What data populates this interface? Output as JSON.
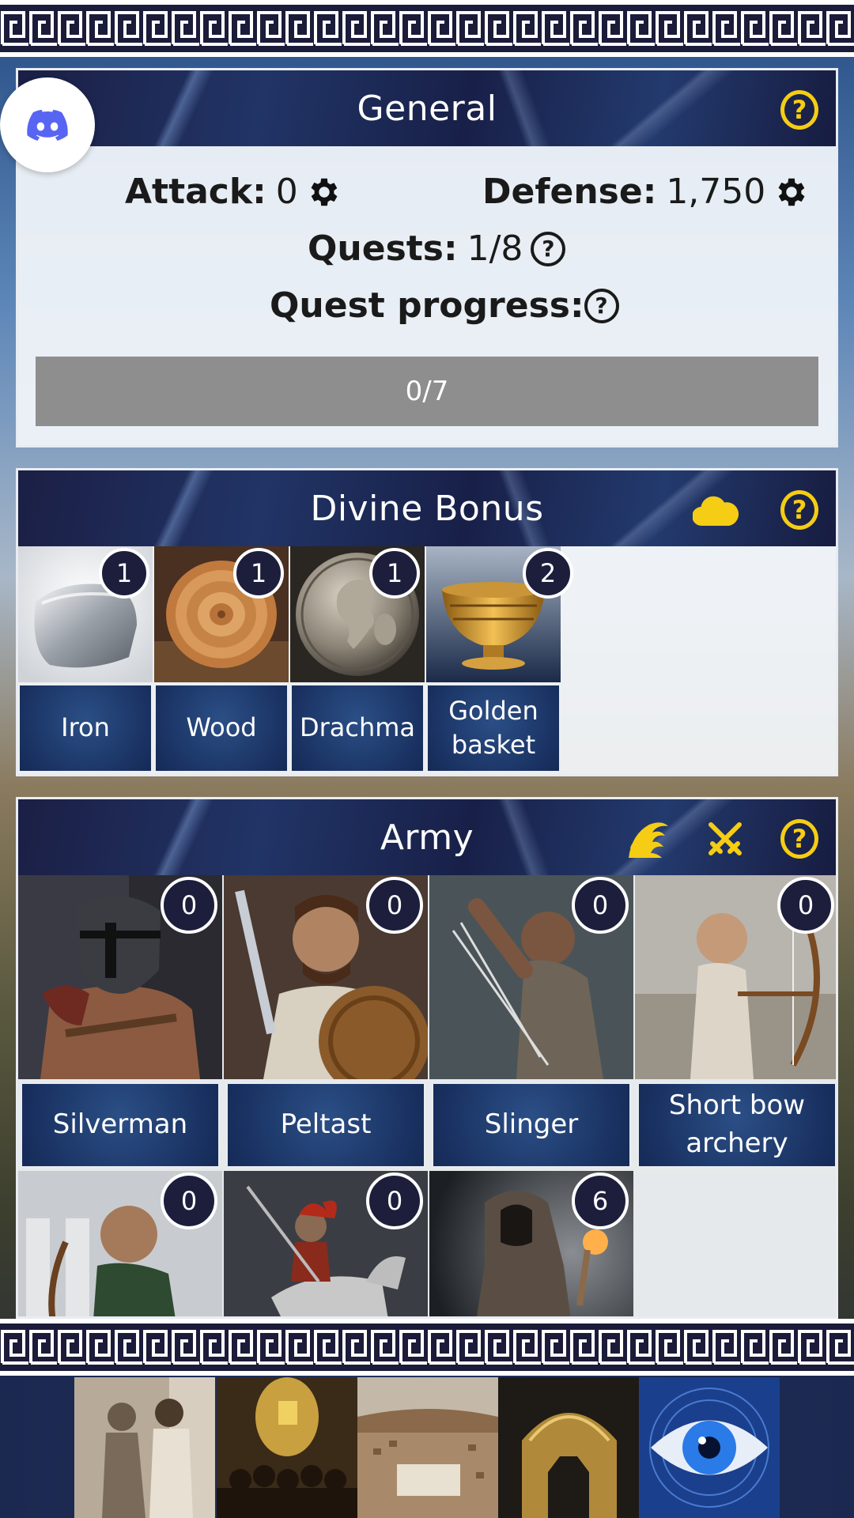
{
  "general": {
    "title": "General",
    "attack_label": "Attack:",
    "attack_value": "0",
    "defense_label": "Defense:",
    "defense_value": "1,750",
    "quests_label": "Quests:",
    "quests_value": "1/8",
    "quest_progress_label": "Quest progress:",
    "progress_text": "0/7",
    "progress_fraction": 0
  },
  "divine": {
    "title": "Divine Bonus",
    "resources": [
      {
        "label": "Iron",
        "count": "1"
      },
      {
        "label": "Wood",
        "count": "1"
      },
      {
        "label": "Drachma",
        "count": "1"
      },
      {
        "label": "Golden basket",
        "count": "2"
      }
    ]
  },
  "army": {
    "title": "Army",
    "units": [
      {
        "label": "Silverman",
        "count": "0"
      },
      {
        "label": "Peltast",
        "count": "0"
      },
      {
        "label": "Slinger",
        "count": "0"
      },
      {
        "label": "Short bow archery",
        "count": "0"
      },
      {
        "label": "",
        "count": "0"
      },
      {
        "label": "",
        "count": "0"
      },
      {
        "label": "",
        "count": "6"
      }
    ]
  },
  "colors": {
    "accent_yellow": "#f5cd14",
    "panel_header": "#1b1f45",
    "label_blue": "#1b3465",
    "badge_bg": "#1c1e3c",
    "progress_track": "#8e8e8e",
    "discord": "#5865f2"
  },
  "icons": [
    "discord-icon",
    "help-icon",
    "gear-icon",
    "cloud-icon",
    "wave-icon",
    "crossed-swords-icon"
  ]
}
